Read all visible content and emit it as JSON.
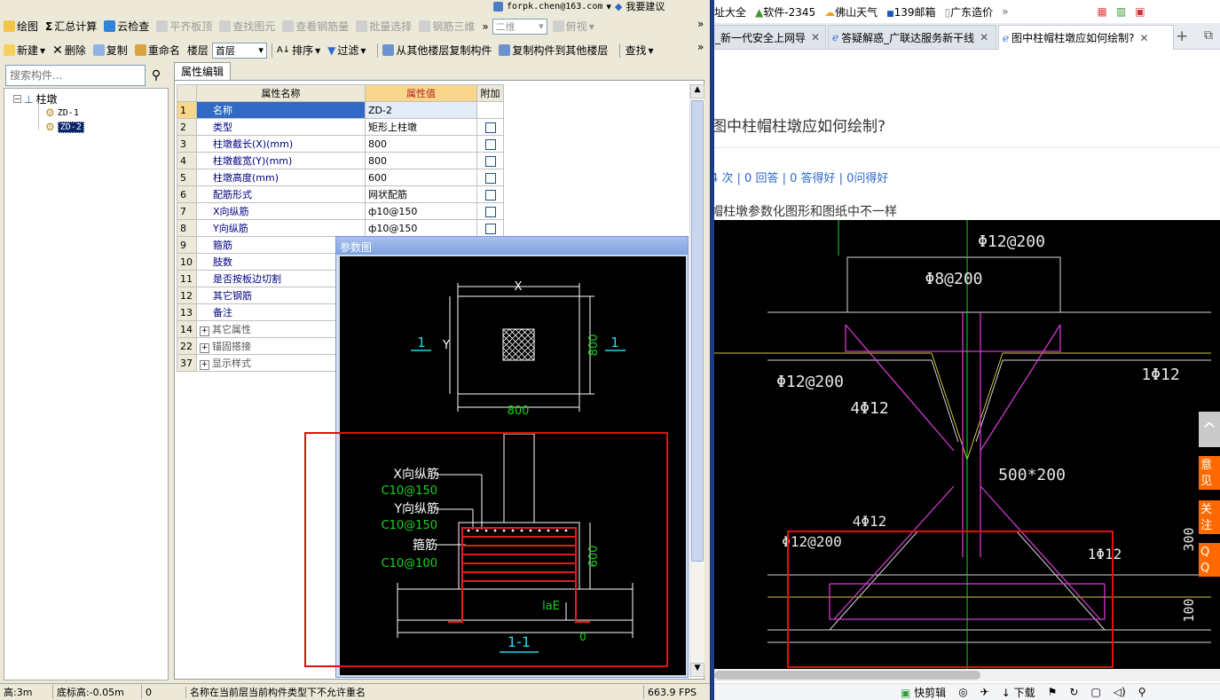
{
  "app": {
    "user_email": "forpk.chen@163.com",
    "suggest_label": "我要建议",
    "toolbar1": {
      "draw": "绘图",
      "summary": "汇总计算",
      "cloud_check": "云检查",
      "align_top": "平齐板顶",
      "find_element": "查找图元",
      "view_rebar": "查看钢筋量",
      "batch_select": "批量选择",
      "rebar_3d": "钢筋三维",
      "view_mode": "二维",
      "view_dir": "俯视"
    },
    "toolbar2": {
      "new": "新建",
      "delete": "删除",
      "copy": "复制",
      "rename": "重命名",
      "floor_label": "楼层",
      "floor_value": "首层",
      "sort": "排序",
      "filter": "过滤",
      "copy_from": "从其他楼层复制构件",
      "copy_to": "复制构件到其他楼层",
      "find": "查找"
    },
    "search_placeholder": "搜索构件...",
    "tree": {
      "root": "柱墩",
      "items": [
        "ZD-1",
        "ZD-2"
      ],
      "selected": "ZD-2"
    },
    "prop_tab": "属性编辑",
    "prop_table": {
      "headers": [
        "属性名称",
        "属性值",
        "附加"
      ],
      "rows": [
        {
          "num": "1",
          "name": "名称",
          "value": "ZD-2",
          "check": false
        },
        {
          "num": "2",
          "name": "类型",
          "value": "矩形上柱墩",
          "check": true
        },
        {
          "num": "3",
          "name": "柱墩截长(X)(mm)",
          "value": "800",
          "check": true
        },
        {
          "num": "4",
          "name": "柱墩截宽(Y)(mm)",
          "value": "800",
          "check": true
        },
        {
          "num": "5",
          "name": "柱墩高度(mm)",
          "value": "600",
          "check": true
        },
        {
          "num": "6",
          "name": "配筋形式",
          "value": "网状配筋",
          "check": true
        },
        {
          "num": "7",
          "name": "X向纵筋",
          "value": "ф10@150",
          "check": true
        },
        {
          "num": "8",
          "name": "Y向纵筋",
          "value": "ф10@150",
          "check": true
        },
        {
          "num": "9",
          "name": "箍筋",
          "value": "",
          "check": false
        },
        {
          "num": "10",
          "name": "肢数",
          "value": "",
          "check": false
        },
        {
          "num": "11",
          "name": "是否按板边切割",
          "value": "",
          "check": false
        },
        {
          "num": "12",
          "name": "其它钢筋",
          "value": "",
          "check": false
        },
        {
          "num": "13",
          "name": "备注",
          "value": "",
          "check": false
        },
        {
          "num": "14",
          "name": "其它属性",
          "value": "",
          "check": false,
          "group": true
        },
        {
          "num": "22",
          "name": "锚固搭接",
          "value": "",
          "check": false,
          "group": true
        },
        {
          "num": "37",
          "name": "显示样式",
          "value": "",
          "check": false,
          "group": true
        }
      ]
    },
    "param_dialog": {
      "title": "参数图",
      "label_x": "X",
      "label_y": "Y",
      "dim_width": "800",
      "dim_height": "800",
      "section_mark": "1",
      "label_x_rebar": "X向纵筋",
      "val_x_rebar": "C10@150",
      "label_y_rebar": "Y向纵筋",
      "val_y_rebar": "C10@150",
      "label_stirrup": "箍筋",
      "val_stirrup": "C10@100",
      "dim_600": "600",
      "dim_lae": "laE",
      "dim_zero": "0",
      "section_title": "1-1"
    },
    "status": {
      "height": "高:3m",
      "base": "底标高:-0.05m",
      "zero": "0",
      "message": "名称在当前层当前构件类型下不允许重名",
      "fps": "663.9 FPS"
    }
  },
  "browser": {
    "bookmarks": [
      "址大全",
      "软件-2345",
      "佛山天气",
      "139邮箱",
      "广东造价"
    ],
    "more": "»",
    "tabs": [
      {
        "label": "_新一代安全上网导",
        "active": false
      },
      {
        "label": "答疑解惑_广联达服务新干线",
        "active": false
      },
      {
        "label": "图中柱帽柱墩应如何绘制?",
        "active": true
      }
    ],
    "question_title": "图中柱帽柱墩应如何绘制?",
    "stats": "4 次 | 0 回答 | 0 答得好 | 0问得好",
    "body": "帽柱墩参数化图形和图纸中不一样",
    "cad": {
      "t1": "Φ12@200",
      "t2": "Φ8@200",
      "t3": "Φ12@200",
      "t4": "4Φ12",
      "t5": "1Φ12",
      "t6": "500*200",
      "t7": "4Φ12",
      "t8": "Φ12@200",
      "t9": "1Φ12",
      "t10": "300",
      "t11": "100"
    },
    "side_buttons": [
      "意见反馈",
      "关注我们",
      "QQ咨询"
    ],
    "bottom": {
      "clip": "快剪辑",
      "download": "下载"
    }
  }
}
